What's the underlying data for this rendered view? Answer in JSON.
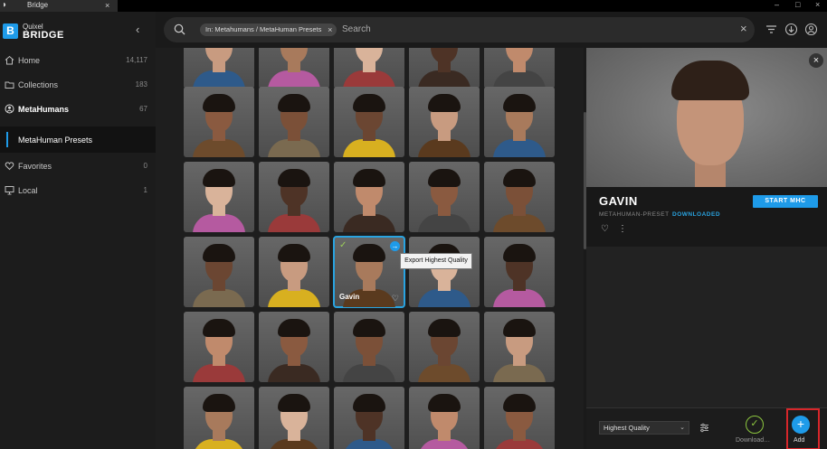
{
  "window": {
    "title": "Bridge",
    "tab_close": "×",
    "minimize": "–",
    "maximize": "□",
    "close": "×"
  },
  "brand": {
    "line1": "Quixel",
    "line2": "BRIDGE",
    "mark": "B"
  },
  "sidebar": {
    "collapse": "‹",
    "items": [
      {
        "label": "Home",
        "count": "14,117",
        "icon": "home-icon"
      },
      {
        "label": "Collections",
        "count": "183",
        "icon": "collections-icon"
      },
      {
        "label": "MetaHumans",
        "count": "67",
        "icon": "metahuman-icon"
      },
      {
        "label": "Favorites",
        "count": "0",
        "icon": "heart-icon"
      },
      {
        "label": "Local",
        "count": "1",
        "icon": "monitor-icon"
      }
    ],
    "sub_item": "MetaHuman Presets"
  },
  "search": {
    "chip": "In: Metahumans / MetaHuman Presets",
    "chip_close": "×",
    "placeholder": "Search",
    "clear": "×",
    "tools": [
      "filter-icon",
      "download-icon",
      "account-icon"
    ]
  },
  "grid": {
    "selected_name": "Gavin",
    "check": "✓",
    "export_icon": "→",
    "heart": "♡",
    "tooltip": "Export Highest Quality"
  },
  "detail": {
    "close": "×",
    "name": "GAVIN",
    "type": "METAHUMAN-PRESET",
    "status": "DOWNLOADED",
    "start_label": "START MHC",
    "heart": "♡",
    "more": "⋮",
    "quality": "Highest Quality",
    "quality_chevron": "⌄",
    "download_label": "Download…",
    "download_icon": "✓",
    "add_label": "Add",
    "add_icon": "+"
  },
  "colors": {
    "accent": "#1e9be9",
    "download_green": "#8cc63f",
    "highlight_red": "#d7262a"
  }
}
